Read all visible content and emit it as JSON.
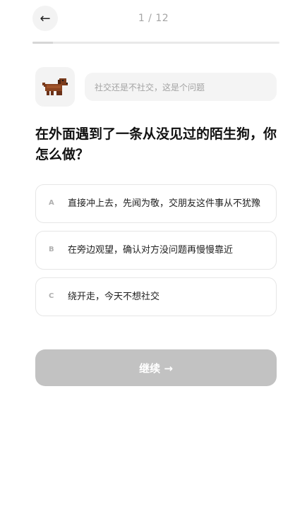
{
  "header": {
    "back_icon": "←",
    "progress_label": "1 / 12",
    "progress_fraction": 0.083
  },
  "prompt": {
    "avatar_icon": "dog-icon",
    "bubble_text": "社交还是不社交，这是个问题"
  },
  "question": {
    "text": "在外面遇到了一条从没见过的陌生狗，你怎么做？"
  },
  "options": [
    {
      "letter": "A",
      "text": "直接冲上去，先闻为敬，交朋友这件事从不犹豫"
    },
    {
      "letter": "B",
      "text": "在旁边观望，确认对方没问题再慢慢靠近"
    },
    {
      "letter": "C",
      "text": "绕开走，今天不想社交"
    }
  ],
  "footer": {
    "continue_label": "继续 →"
  },
  "colors": {
    "button_disabled": "#c2c2c2",
    "card_border": "#e6e6e6",
    "muted_text": "#a5a5a5"
  }
}
